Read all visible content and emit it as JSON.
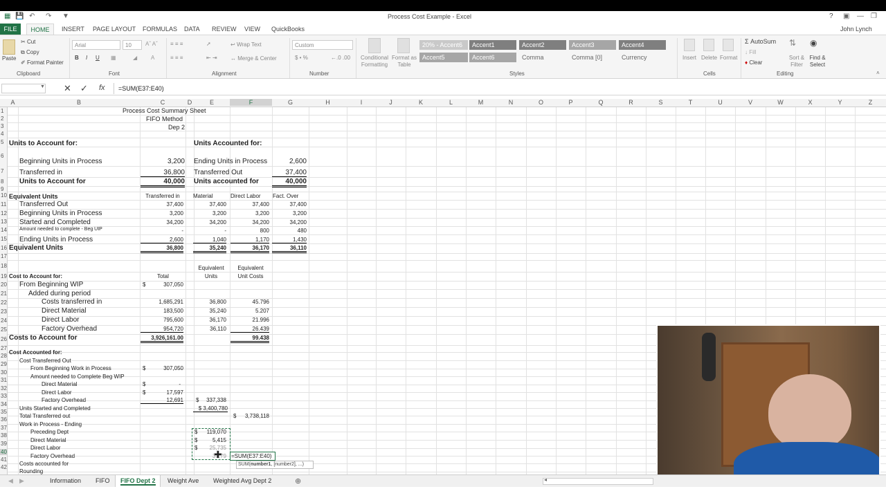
{
  "window": {
    "title": "Process Cost Example - Excel",
    "user": "John Lynch",
    "help": "?"
  },
  "ribbon_tabs": [
    "FILE",
    "HOME",
    "INSERT",
    "PAGE LAYOUT",
    "FORMULAS",
    "DATA",
    "REVIEW",
    "VIEW",
    "QuickBooks"
  ],
  "ribbon": {
    "clipboard": {
      "label": "Clipboard",
      "paste": "Paste",
      "cut": "Cut",
      "copy": "Copy",
      "painter": "Format Painter"
    },
    "font": {
      "label": "Font",
      "name": "Arial",
      "size": "10"
    },
    "alignment": {
      "label": "Alignment",
      "wrap": "Wrap Text",
      "merge": "Merge & Center"
    },
    "number": {
      "label": "Number",
      "format": "Custom"
    },
    "styles": {
      "label": "Styles",
      "conditional": "Conditional Formatting",
      "format_table": "Format as Table",
      "cells": [
        "20% - Accent6",
        "Accent1",
        "Accent2",
        "Accent3",
        "Accent4",
        "Accent5",
        "Accent6",
        "Comma",
        "Comma [0]",
        "Currency"
      ]
    },
    "cells_group": {
      "label": "Cells",
      "insert": "Insert",
      "delete": "Delete",
      "format": "Format"
    },
    "editing": {
      "label": "Editing",
      "autosum": "AutoSum",
      "fill": "Fill",
      "clear": "Clear",
      "sort": "Sort & Filter",
      "find": "Find & Select"
    }
  },
  "formula_bar": {
    "name_box": "",
    "formula": "=SUM(E37:E40)",
    "fx": "fx"
  },
  "columns": [
    "A",
    "B",
    "C",
    "D",
    "E",
    "F",
    "G",
    "H",
    "I",
    "J",
    "K",
    "L",
    "M",
    "N",
    "O",
    "P",
    "Q",
    "R",
    "S",
    "T",
    "U",
    "V",
    "W",
    "X",
    "Y",
    "Z"
  ],
  "rows": [
    "1",
    "2",
    "3",
    "4",
    "5",
    "6",
    "7",
    "8",
    "9",
    "10",
    "11",
    "12",
    "13",
    "14",
    "15",
    "16",
    "17",
    "18",
    "19",
    "20",
    "21",
    "22",
    "23",
    "24",
    "25",
    "26",
    "27",
    "28",
    "29",
    "30",
    "31",
    "32",
    "33",
    "34",
    "35",
    "36",
    "37",
    "38",
    "39",
    "40",
    "41",
    "42"
  ],
  "sheet": {
    "r1": "Process Cost Summary Sheet",
    "r2": "FIFO Method",
    "r3": "Dep 2",
    "units_to_account": "Units to Account for:",
    "units_accounted": "Units Accounted for:",
    "beg_wip": "Beginning Units in Process",
    "beg_wip_val": "3,200",
    "end_wip": "Ending Units in Process",
    "end_wip_val": "2,600",
    "transferred_in": "Transferred in",
    "transferred_in_val": "36,800",
    "transferred_out": "Transferred Out",
    "transferred_out_val": "37,400",
    "units_total_label": "Units to Account for",
    "units_total_val": "40,000",
    "units_acc_total_label": "Units accounted for",
    "units_acc_total_val": "40,000",
    "eq_units": "Equivalent Units",
    "eq_headers": [
      "Transferred in",
      "Material",
      "Direct Labor",
      "Fact. Over"
    ],
    "eq_rows": [
      {
        "label": "Transferred Out",
        "vals": [
          "37,400",
          "37,400",
          "37,400",
          "37,400"
        ]
      },
      {
        "label": "Beginning Units in Process",
        "vals": [
          "3,200",
          "3,200",
          "3,200",
          "3,200"
        ]
      },
      {
        "label": "Started and Completed",
        "vals": [
          "34,200",
          "34,200",
          "34,200",
          "34,200"
        ]
      },
      {
        "label": "Amount needed to complete - Beg UIP",
        "vals": [
          "-",
          "-",
          "800",
          "480"
        ]
      },
      {
        "label": "Ending Units in Process",
        "vals": [
          "2,600",
          "1,040",
          "1,170",
          "1,430"
        ]
      }
    ],
    "eq_total_label": "Equivalent Units",
    "eq_total": [
      "36,800",
      "35,240",
      "36,170",
      "36,110"
    ],
    "eu_header1": "Equivalent",
    "eu_header2": "Units",
    "euc_header1": "Equivalent",
    "euc_header2": "Unit Costs",
    "cost_to_account": "Cost to Account for:",
    "total": "Total",
    "from_beg_wip": "From Beginning WIP",
    "from_beg_wip_sign": "$",
    "from_beg_wip_val": "307,050",
    "added": "Added during period",
    "cost_rows": [
      {
        "label": "Costs transferred in",
        "total": "1,685,291",
        "eu": "36,800",
        "euc": "45.796"
      },
      {
        "label": "Direct Material",
        "total": "183,500",
        "eu": "35,240",
        "euc": "5.207"
      },
      {
        "label": "Direct Labor",
        "total": "795,600",
        "eu": "36,170",
        "euc": "21.996"
      },
      {
        "label": "Factory Overhead",
        "total": "954,720",
        "eu": "36,110",
        "euc": "26.439"
      }
    ],
    "costs_total_label": "Costs to Account for",
    "costs_total_val": "3,926,161.00",
    "costs_total_euc": "99.438",
    "cost_accounted": "Cost Accounted for:",
    "cost_transferred_out": "Cost Transferred Out",
    "from_beg_work": "From Beginning Work in Process",
    "from_beg_work_sign": "$",
    "from_beg_work_val": "307,050",
    "amount_needed": "Amount needed to Complete Beg WIP",
    "an_dm": "Direct Material",
    "an_dm_sign": "$",
    "an_dm_val": "-",
    "an_dl": "Direct Labor",
    "an_dl_sign": "$",
    "an_dl_val": "17,597",
    "an_fo": "Factory Overhead",
    "an_fo_val": "12,691",
    "an_sub_sign": "$",
    "an_sub_val": "337,338",
    "started_completed": "Units Started and Completed",
    "sc_val": "$ 3,400,780",
    "total_transferred": "Total Transferred out",
    "tt_sign": "$",
    "tt_val": "3,738,118",
    "wip_ending": "Work in Process - Ending",
    "preceding": "Preceding Dept",
    "preceding_sign": "$",
    "preceding_val": "119,070",
    "wip_dm": "Direct Material",
    "wip_dm_sign": "$",
    "wip_dm_val": "5,415",
    "wip_dl": "Direct Labor",
    "wip_dl_sign": "$",
    "wip_dl_val": "25,735",
    "wip_fo": "Factory Overhead",
    "wip_fo_val": "37,79",
    "edit_formula": "=SUM(E37:E40)",
    "tooltip_fn": "SUM(",
    "tooltip_arg1": "number1",
    ", ": ", ",
    "tooltip_rest": "[number2], ...)",
    "costs_accounted": "Costs accounted for",
    "rounding": "Rounding"
  },
  "sheet_tabs": [
    "Information",
    "FIFO",
    "FIFO Dept 2",
    "Weight Ave",
    "Weighted Avg Dept 2"
  ],
  "active_sheet": "FIFO Dept 2",
  "colors": {
    "excel_green": "#217346",
    "accent1": "#7f7f7f",
    "style_dark": "#595959",
    "selection": "#217346"
  }
}
